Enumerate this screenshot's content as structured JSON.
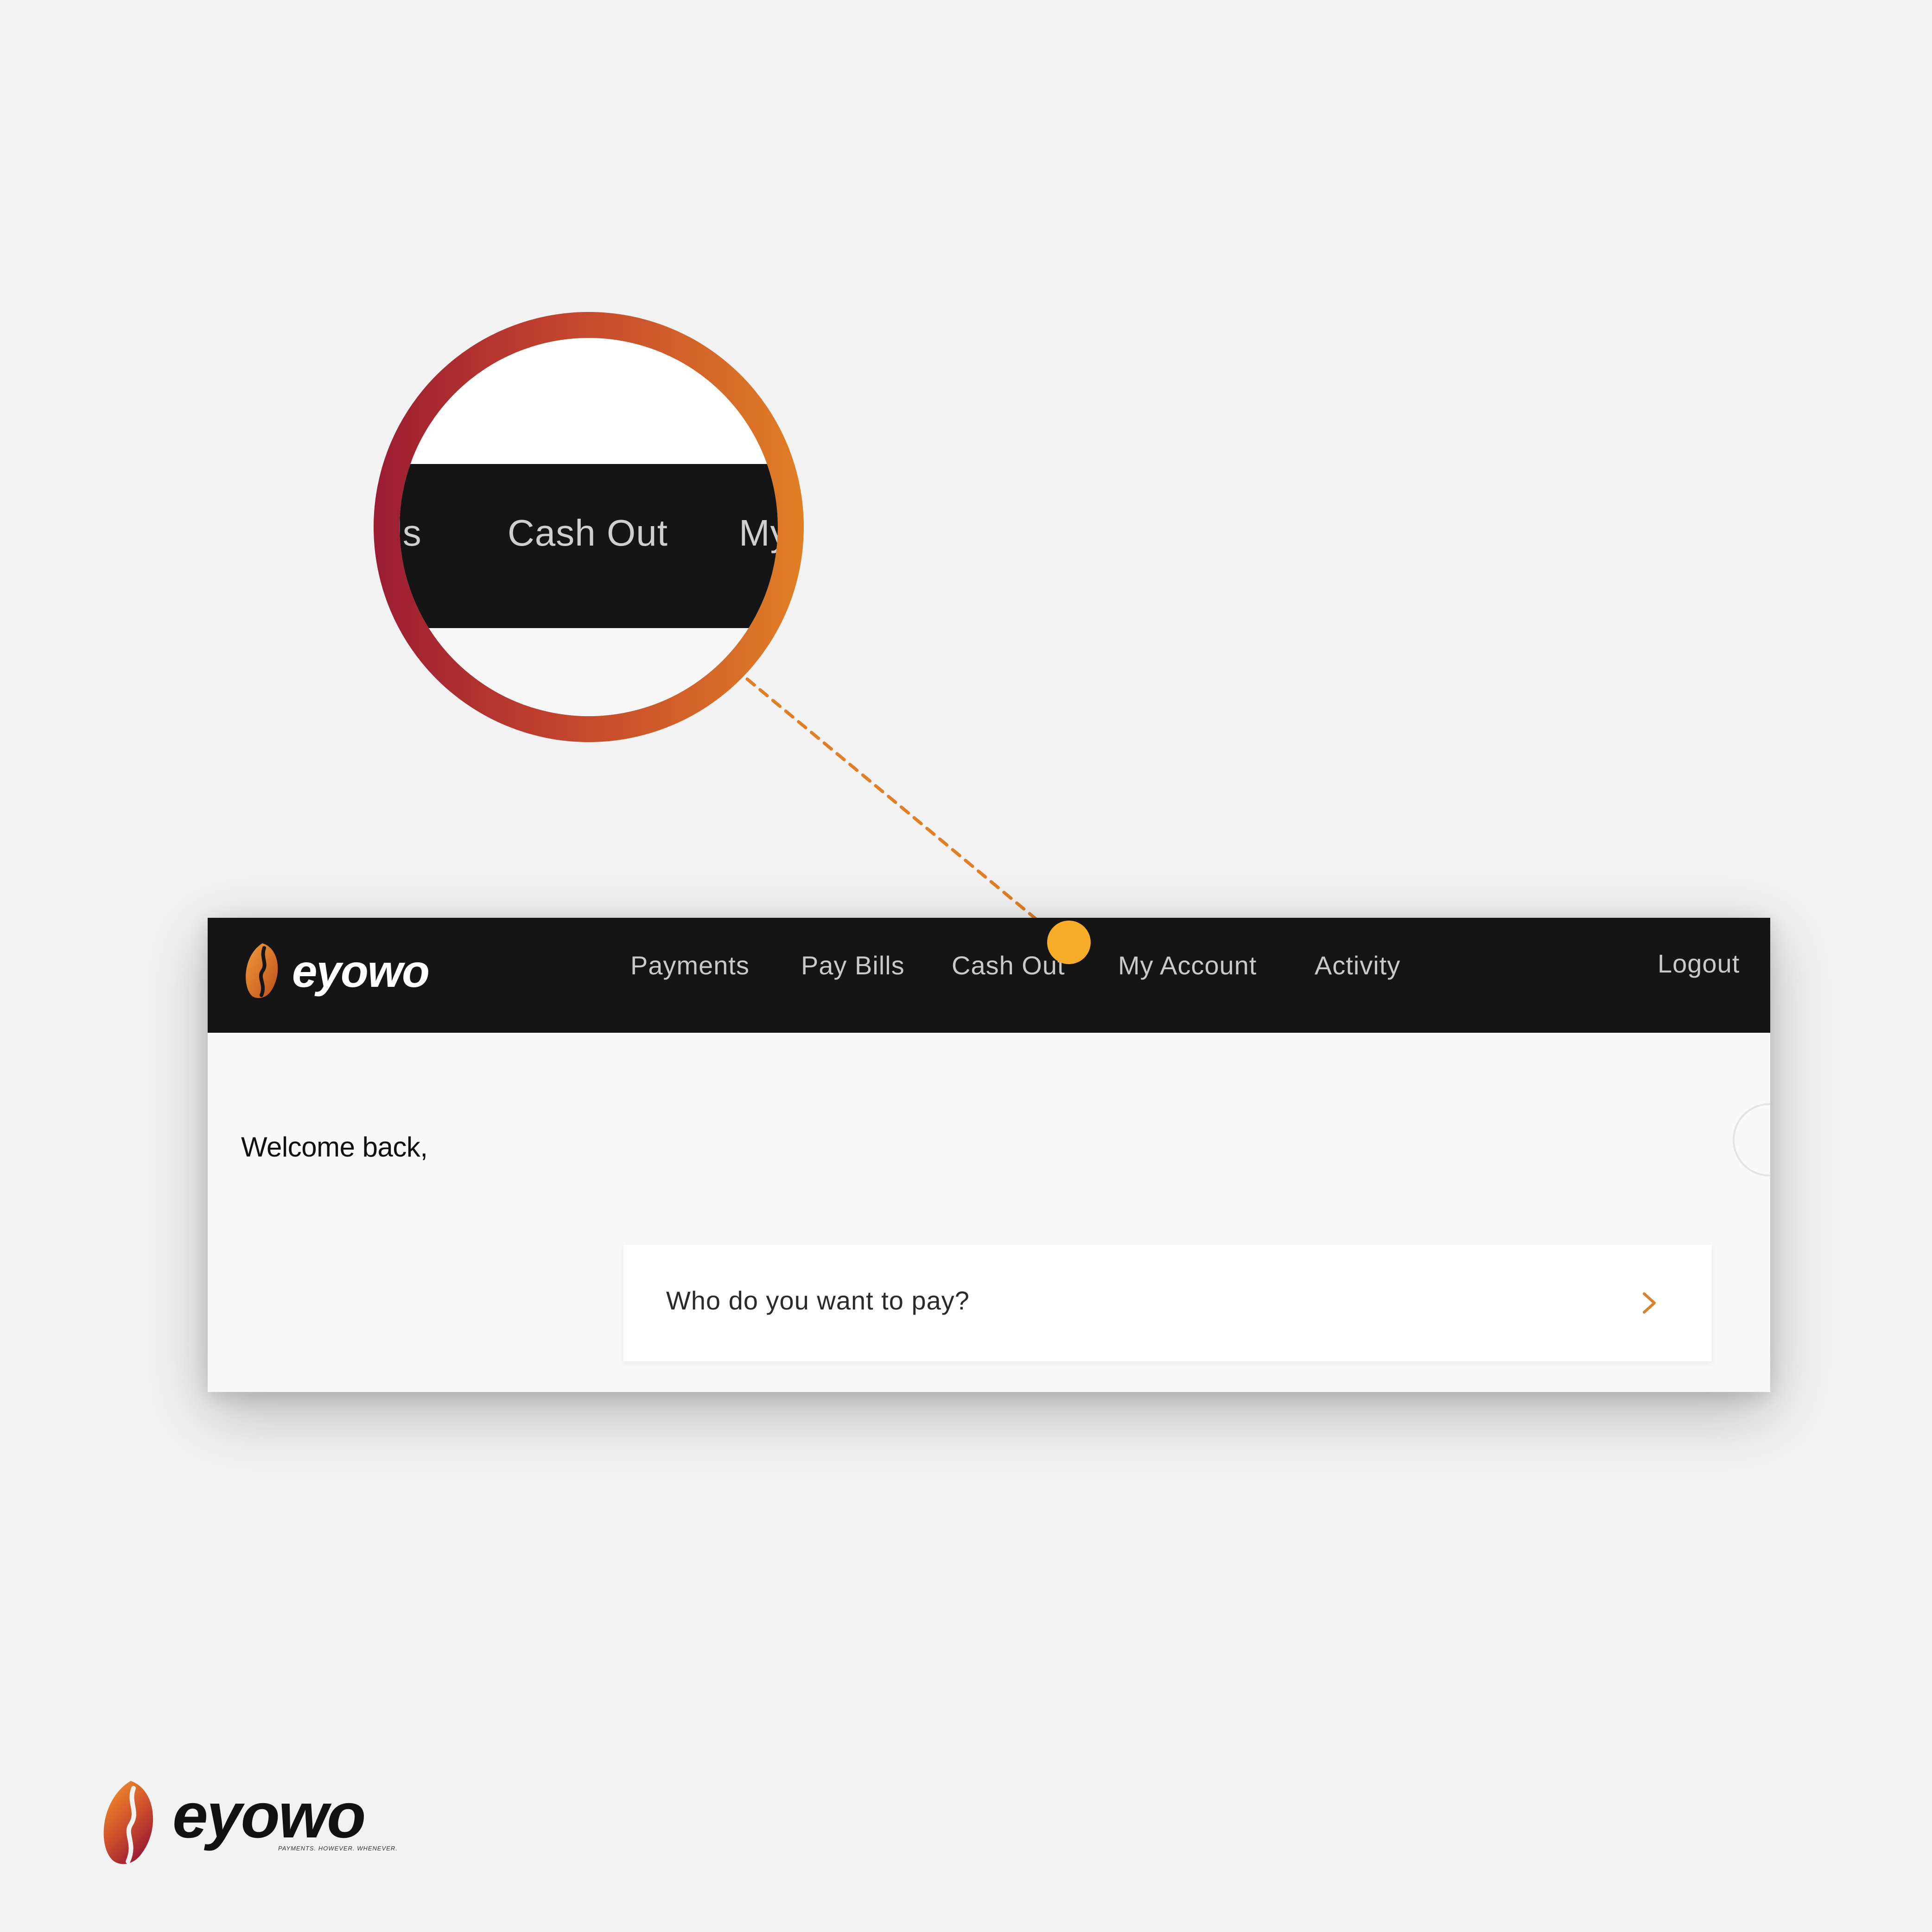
{
  "colors": {
    "background": "#f2f2f2",
    "navbar": "#151515",
    "nav_text": "#c9c9c9",
    "accent_orange": "#e07f25",
    "accent_red": "#9b1c32",
    "hotspot": "#f7ad2a"
  },
  "magnifier": {
    "partial_left": "ls",
    "label": "Cash Out",
    "partial_right": "My"
  },
  "navbar": {
    "brand": "eyowo",
    "items": [
      "Payments",
      "Pay Bills",
      "Cash Out",
      "My Account",
      "Activity"
    ],
    "logout": "Logout"
  },
  "main": {
    "welcome": "Welcome back,",
    "pay_prompt": "Who do you want to pay?"
  },
  "footer": {
    "brand": "eyowo",
    "tagline": "PAYMENTS. HOWEVER. WHENEVER."
  }
}
